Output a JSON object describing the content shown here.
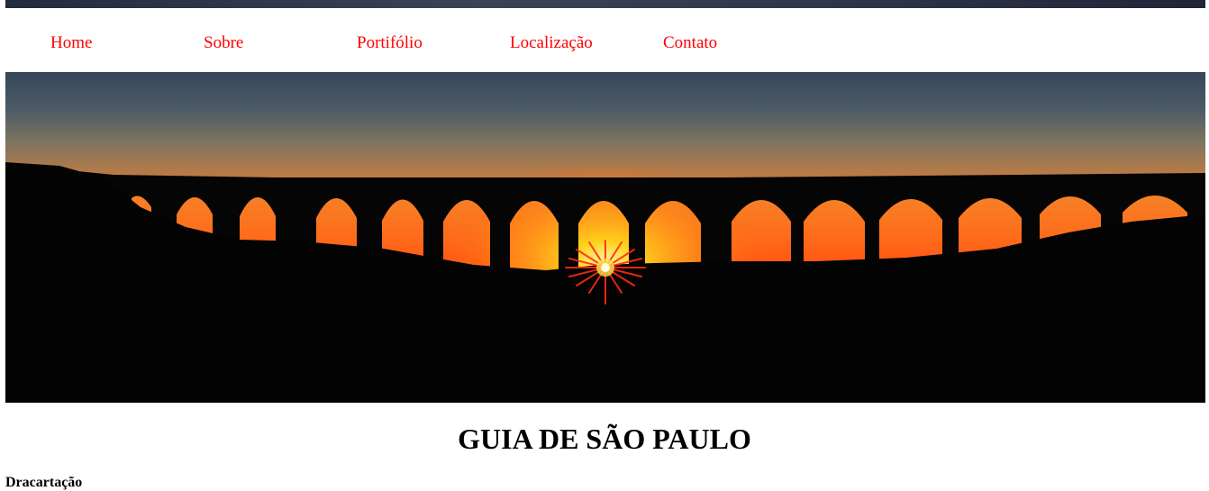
{
  "nav": {
    "items": [
      {
        "label": "Home"
      },
      {
        "label": "Sobre"
      },
      {
        "label": "Portifólio"
      },
      {
        "label": "Localização"
      },
      {
        "label": "Contato"
      }
    ]
  },
  "hero": {
    "icon": "aqueduct-sunset-photo"
  },
  "page_title": "GUIA DE SÃO PAULO",
  "section_heading": "Dracartação",
  "colors": {
    "link": "#ff0000",
    "text": "#000000",
    "background": "#ffffff"
  }
}
